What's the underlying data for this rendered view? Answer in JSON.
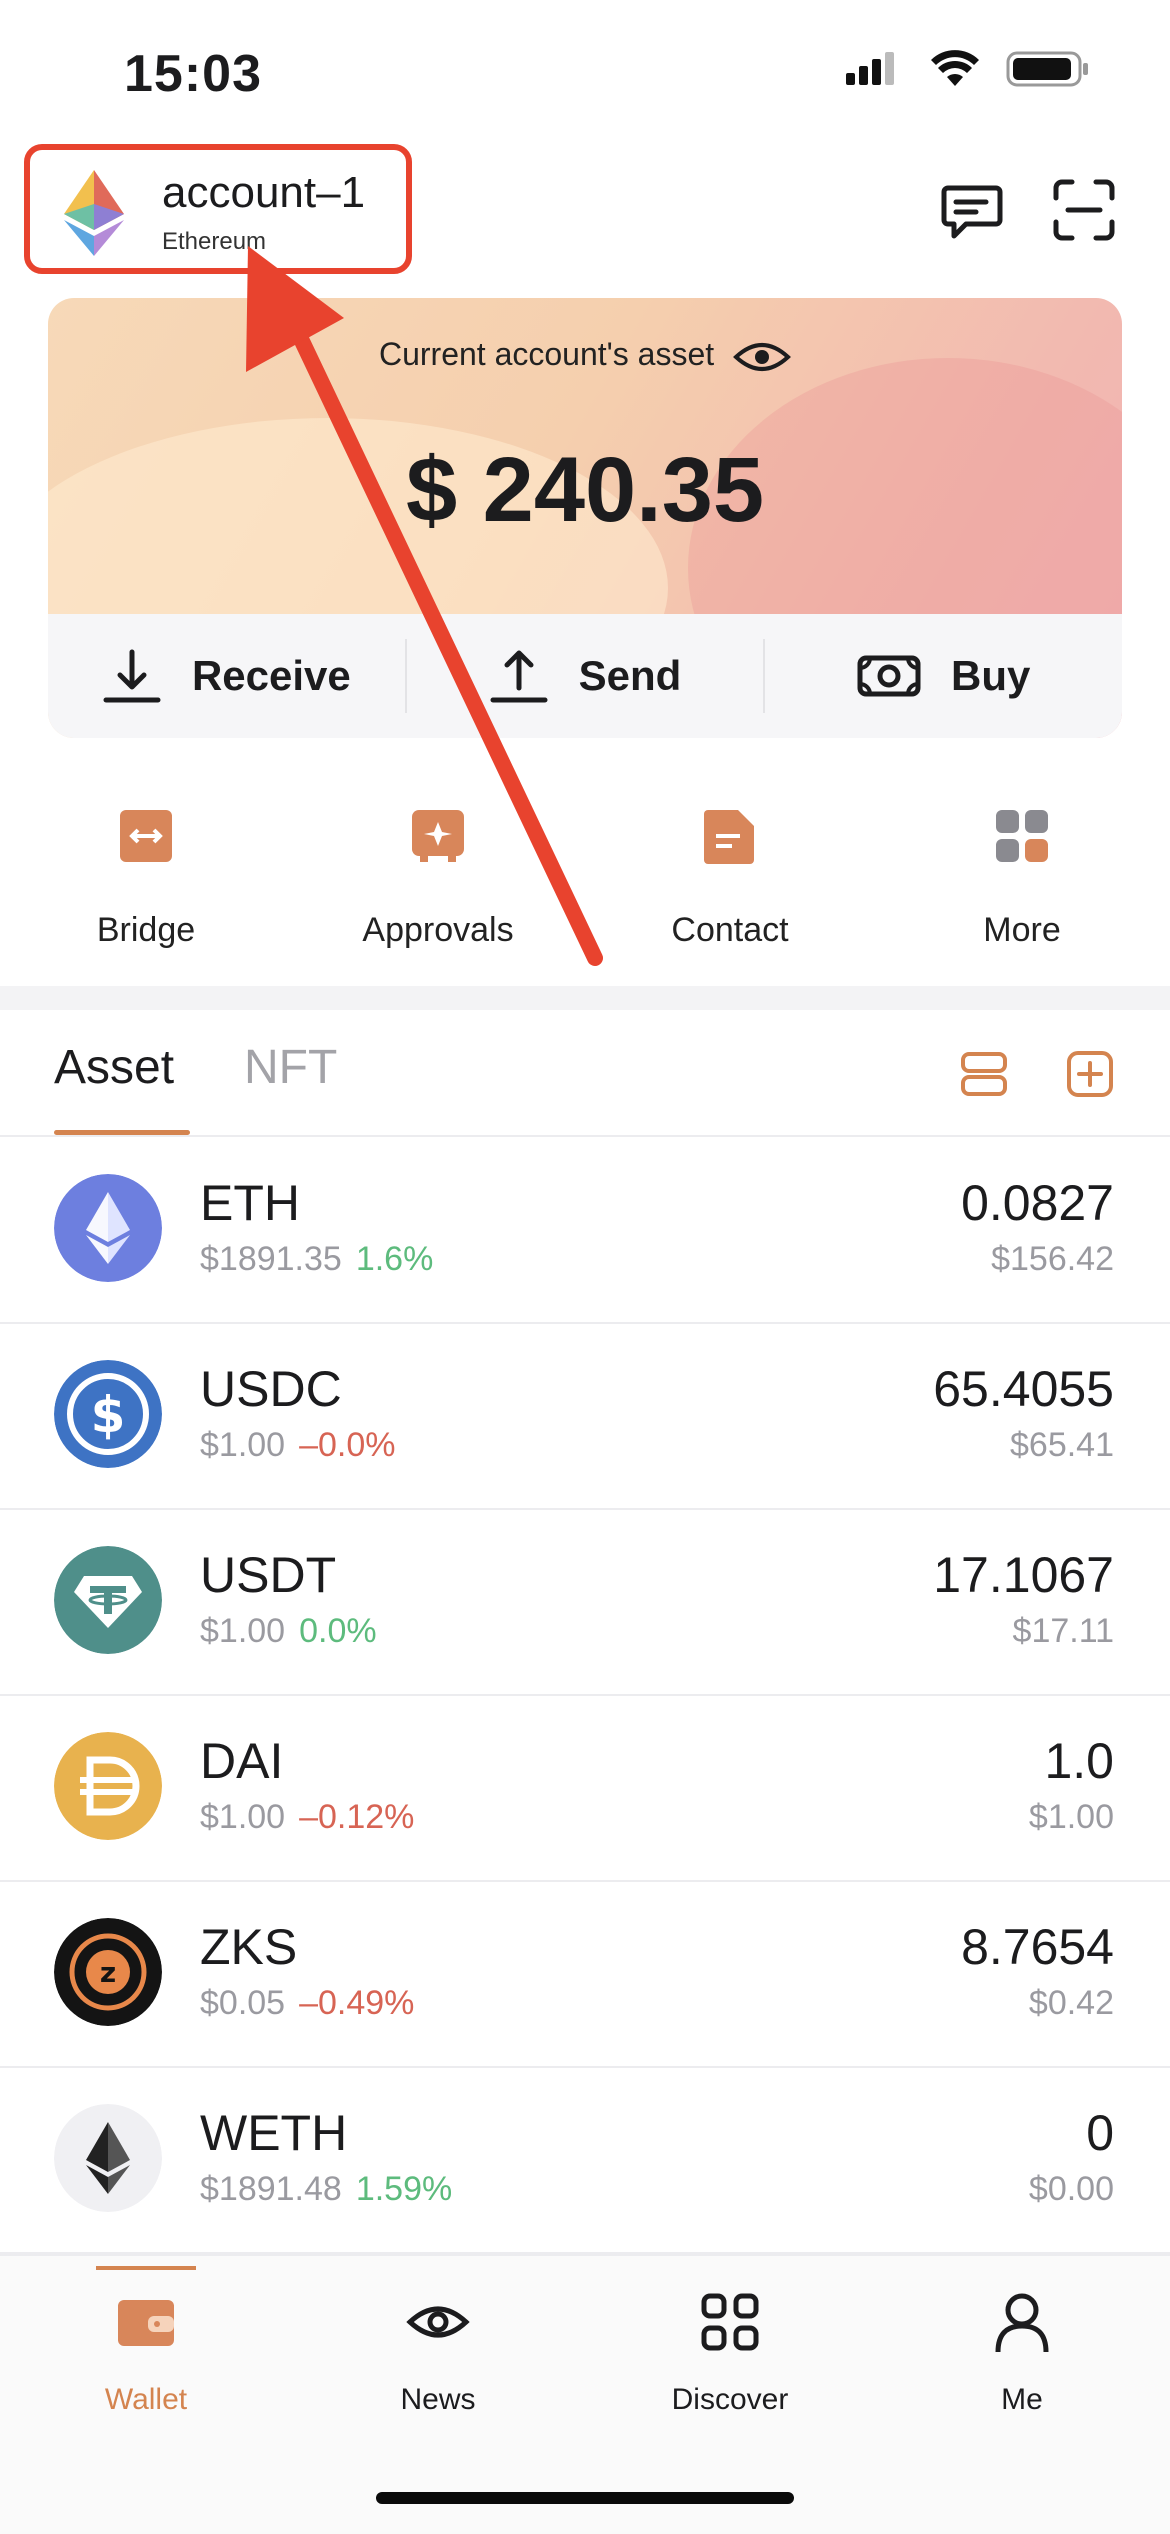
{
  "status_bar": {
    "time": "15:03"
  },
  "header": {
    "account_name": "account–1",
    "chain": "Ethereum",
    "icons": [
      "chat-icon",
      "scan-icon"
    ]
  },
  "asset_card": {
    "label": "Current account's asset",
    "total_value": "$ 240.35"
  },
  "actions": [
    {
      "label": "Receive",
      "icon": "download-icon"
    },
    {
      "label": "Send",
      "icon": "upload-icon"
    },
    {
      "label": "Buy",
      "icon": "cash-icon"
    }
  ],
  "tools": [
    {
      "label": "Bridge",
      "icon": "bridge-icon"
    },
    {
      "label": "Approvals",
      "icon": "approvals-icon"
    },
    {
      "label": "Contact",
      "icon": "contact-icon"
    },
    {
      "label": "More",
      "icon": "more-grid-icon"
    }
  ],
  "tabs": {
    "active": "Asset",
    "inactive": "NFT"
  },
  "assets": [
    {
      "symbol": "ETH",
      "price": "$1891.35",
      "change": "1.6%",
      "direction": "up",
      "amount": "0.0827",
      "value": "$156.42"
    },
    {
      "symbol": "USDC",
      "price": "$1.00",
      "change": "–0.0%",
      "direction": "down",
      "amount": "65.4055",
      "value": "$65.41"
    },
    {
      "symbol": "USDT",
      "price": "$1.00",
      "change": "0.0%",
      "direction": "up",
      "amount": "17.1067",
      "value": "$17.11"
    },
    {
      "symbol": "DAI",
      "price": "$1.00",
      "change": "–0.12%",
      "direction": "down",
      "amount": "1.0",
      "value": "$1.00"
    },
    {
      "symbol": "ZKS",
      "price": "$0.05",
      "change": "–0.49%",
      "direction": "down",
      "amount": "8.7654",
      "value": "$0.42"
    },
    {
      "symbol": "WETH",
      "price": "$1891.48",
      "change": "1.59%",
      "direction": "up",
      "amount": "0",
      "value": "$0.00"
    }
  ],
  "tabbar": [
    {
      "label": "Wallet",
      "active": true
    },
    {
      "label": "News",
      "active": false
    },
    {
      "label": "Discover",
      "active": false
    },
    {
      "label": "Me",
      "active": false
    }
  ],
  "colors": {
    "accent": "#d4844f",
    "annotation_red": "#e8432e",
    "up": "#5dbb7d",
    "down": "#d76454"
  }
}
